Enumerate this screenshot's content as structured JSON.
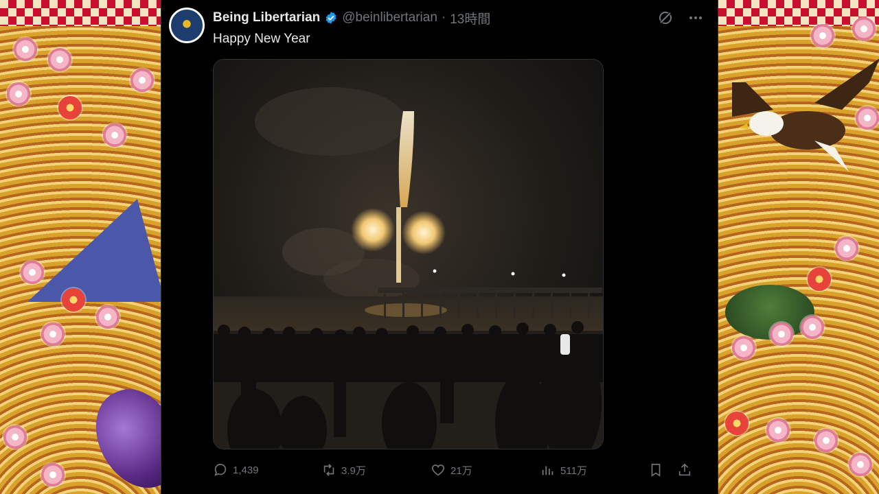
{
  "tweet": {
    "author_name": "Being Libertarian",
    "handle": "@beinlibertarian",
    "separator": "·",
    "time_ago": "13時間",
    "text": "Happy New Year",
    "media_icon": "fireworks-photo",
    "verified_icon": "verified-badge-icon",
    "accent_color": "#1d9bf0"
  },
  "actions": {
    "replies": "1,439",
    "retweets": "3.9万",
    "likes": "21万",
    "views": "511万"
  },
  "icons": {
    "top": [
      "grok-icon",
      "more-icon"
    ],
    "bottom": [
      "reply-icon",
      "retweet-icon",
      "like-icon",
      "views-icon",
      "bookmark-icon",
      "share-icon"
    ]
  }
}
